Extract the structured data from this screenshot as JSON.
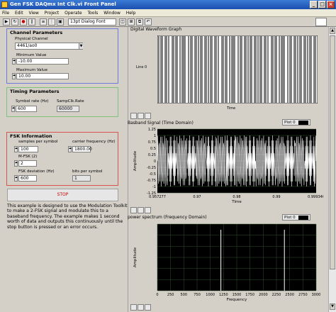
{
  "window": {
    "title": "Gen FSK DAQmx Int Clk.vi Front Panel",
    "buttons": [
      "_",
      "□",
      "×"
    ]
  },
  "menu": [
    "File",
    "Edit",
    "View",
    "Project",
    "Operate",
    "Tools",
    "Window",
    "Help"
  ],
  "toolbar": {
    "font": "13pt Dialog Font"
  },
  "channel": {
    "title": "Channel Parameters",
    "physical_label": "Physical Channel",
    "physical_value": "4461/ao0",
    "min_label": "Minimum Value",
    "min_value": "-10.00",
    "max_label": "Maximum Value",
    "max_value": "10.00"
  },
  "timing": {
    "title": "Timing Parameters",
    "symbol_label": "Symbol rate (Hz)",
    "symbol_value": "600",
    "samp_label": "SampClk.Rate",
    "samp_value": "60000"
  },
  "fsk": {
    "title": "FSK Information",
    "sps_label": "samples per symbol",
    "sps_value": "100",
    "carrier_label": "carrier frequency (Hz)",
    "carrier_value": "1800.00",
    "mfsk_label": "M-FSK (2)",
    "mfsk_value": "2",
    "dev_label": "FSK deviation (Hz)",
    "dev_value": "600",
    "bits_label": "bits per symbol",
    "bits_value": "1"
  },
  "stop_label": "STOP",
  "description": "This example is designed to use the Modulation Toolkit to make a 2-FSK signal and modulate this to a baseband frequency. The example makes 1 second worth of data and outputs this continuously until the stop button is pressed or an error occurs.",
  "graph1": {
    "title": "Digital Waveform Graph",
    "line_label": "Line 0",
    "xlabel": "Time"
  },
  "graph2": {
    "title": "Basband Signal (Time Domain)",
    "plot": "Plot 0",
    "ylabel": "Amplitude",
    "xlabel": "Time",
    "yticks": [
      "1.25",
      "1",
      "0.75",
      "0.5",
      "0.25",
      "0",
      "-0.25",
      "-0.5",
      "-0.75",
      "-1",
      "-1.25"
    ],
    "xticks": [
      "0.957277",
      "0.97",
      "0.98",
      "0.99",
      "0.999346"
    ]
  },
  "graph3": {
    "title": "power spectrum (Frequency Domain)",
    "plot": "Plot 0",
    "ylabel": "Amplitude",
    "xlabel": "Frequency",
    "xticks": [
      "0",
      "250",
      "500",
      "750",
      "1000",
      "1250",
      "1500",
      "1750",
      "2000",
      "2250",
      "2500",
      "2750",
      "3000"
    ]
  }
}
